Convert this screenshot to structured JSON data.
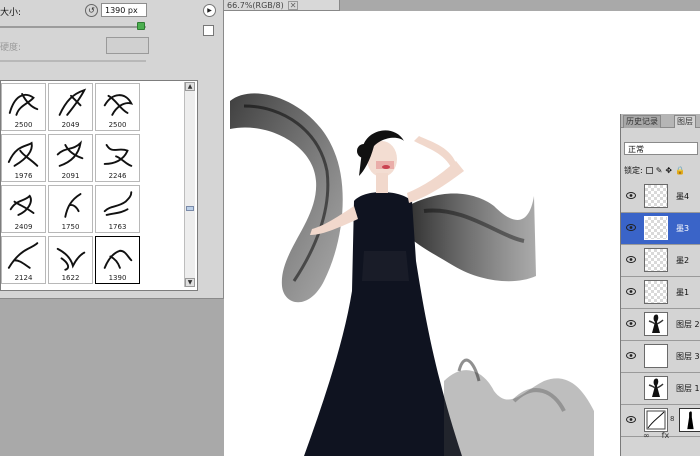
{
  "document": {
    "tab_label": "66.7%(RGB/8)",
    "close_symbol": "✕",
    "background_color": "#ffffff"
  },
  "brush_panel": {
    "size_label": "大小:",
    "size_value": "1390 px",
    "hardness_label": "硬度:",
    "size_slider_fraction": 0.96,
    "brushes": [
      {
        "size": "2500"
      },
      {
        "size": "2049"
      },
      {
        "size": "2500"
      },
      {
        "size": "1976"
      },
      {
        "size": "2091"
      },
      {
        "size": "2246"
      },
      {
        "size": "2409"
      },
      {
        "size": "1750"
      },
      {
        "size": "1763"
      },
      {
        "size": "2124"
      },
      {
        "size": "1622"
      },
      {
        "size": "1390"
      }
    ],
    "selected_brush": "1390",
    "icons": {
      "reset": "reset-icon",
      "panel_menu": "panel-menu-arrow-icon",
      "new_preset": "new-preset-icon",
      "scroll_up": "scroll-up-arrow-icon",
      "scroll_down": "scroll-down-arrow-icon"
    }
  },
  "layers_panel": {
    "tabs": [
      {
        "label": "历史记录",
        "active": false
      },
      {
        "label": "图层",
        "active": true
      }
    ],
    "blend_mode": "正常",
    "lock_label": "锁定:",
    "layers": [
      {
        "name": "墨4",
        "visible": true,
        "active": false,
        "thumb": "transparent"
      },
      {
        "name": "墨3",
        "visible": true,
        "active": true,
        "thumb": "transparent"
      },
      {
        "name": "墨2",
        "visible": true,
        "active": false,
        "thumb": "transparent"
      },
      {
        "name": "墨1",
        "visible": true,
        "active": false,
        "thumb": "transparent"
      },
      {
        "name": "图层 2",
        "visible": true,
        "active": false,
        "thumb": "figure"
      },
      {
        "name": "图层 3",
        "visible": true,
        "active": false,
        "thumb": "white"
      },
      {
        "name": "图层 1",
        "visible": false,
        "active": false,
        "thumb": "figure"
      },
      {
        "name": "",
        "visible": true,
        "active": false,
        "thumb": "adjustment"
      }
    ],
    "footer": {
      "link": "∞",
      "fx": "fx"
    }
  },
  "colors": {
    "selection_blue": "#3a64c8",
    "panel_gray": "#d5d5d5",
    "workspace_gray": "#a9a9a9",
    "slider_green": "#4caf50"
  }
}
